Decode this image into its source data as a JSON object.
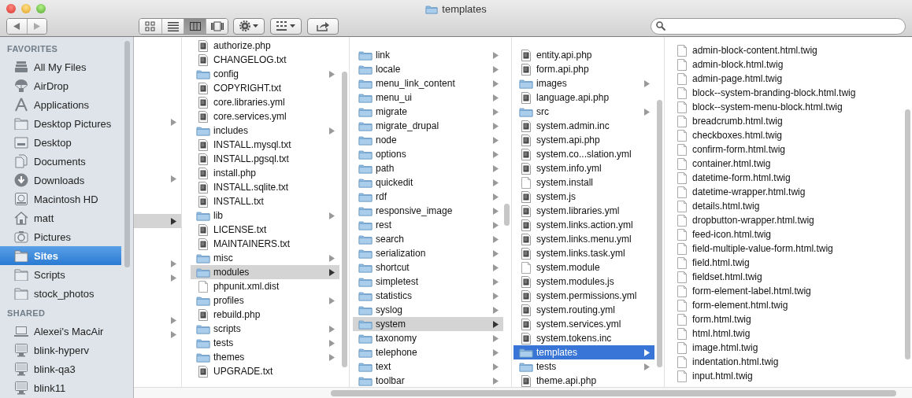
{
  "window": {
    "title": "templates"
  },
  "toolbar": {
    "view_modes": [
      {
        "kind": "icons",
        "selected": false
      },
      {
        "kind": "list",
        "selected": false
      },
      {
        "kind": "columns",
        "selected": true
      },
      {
        "kind": "coverflow",
        "selected": false
      }
    ]
  },
  "sidebar": {
    "sections": [
      {
        "heading": "FAVORITES",
        "items": [
          {
            "label": "All My Files",
            "kind": "files",
            "selected": false
          },
          {
            "label": "AirDrop",
            "kind": "airdrop",
            "selected": false
          },
          {
            "label": "Applications",
            "kind": "applications",
            "selected": false
          },
          {
            "label": "Desktop Pictures",
            "kind": "folder",
            "selected": false
          },
          {
            "label": "Desktop",
            "kind": "desktop",
            "selected": false
          },
          {
            "label": "Documents",
            "kind": "documents",
            "selected": false
          },
          {
            "label": "Downloads",
            "kind": "downloads",
            "selected": false
          },
          {
            "label": "Macintosh HD",
            "kind": "disk",
            "selected": false
          },
          {
            "label": "matt",
            "kind": "home",
            "selected": false
          },
          {
            "label": "Pictures",
            "kind": "camera",
            "selected": false
          },
          {
            "label": "Sites",
            "kind": "folder",
            "selected": true
          },
          {
            "label": "Scripts",
            "kind": "folder",
            "selected": false
          },
          {
            "label": "stock_photos",
            "kind": "folder",
            "selected": false
          }
        ]
      },
      {
        "heading": "SHARED",
        "items": [
          {
            "label": "Alexei's MacAir",
            "kind": "laptop",
            "selected": false
          },
          {
            "label": "blink-hyperv",
            "kind": "monitor",
            "selected": false
          },
          {
            "label": "blink-qa3",
            "kind": "monitor",
            "selected": false
          },
          {
            "label": "blink11",
            "kind": "monitor",
            "selected": false
          }
        ]
      }
    ]
  },
  "columns": [
    {
      "active": false,
      "rows": [
        {
          "expandable": false,
          "selected": false
        },
        {
          "expandable": false,
          "selected": false
        },
        {
          "expandable": false,
          "selected": false
        },
        {
          "expandable": false,
          "selected": false
        },
        {
          "expandable": false,
          "selected": false
        },
        {
          "expandable": true,
          "selected": false
        },
        {
          "expandable": false,
          "selected": false
        },
        {
          "expandable": false,
          "selected": false
        },
        {
          "expandable": false,
          "selected": false
        },
        {
          "expandable": true,
          "selected": false
        },
        {
          "expandable": false,
          "selected": false
        },
        {
          "expandable": false,
          "selected": false
        },
        {
          "expandable": true,
          "selected": true
        },
        {
          "expandable": false,
          "selected": false
        },
        {
          "expandable": false,
          "selected": false
        },
        {
          "expandable": true,
          "selected": false
        },
        {
          "expandable": true,
          "selected": false
        },
        {
          "expandable": false,
          "selected": false
        },
        {
          "expandable": false,
          "selected": false
        },
        {
          "expandable": true,
          "selected": false
        },
        {
          "expandable": true,
          "selected": false
        },
        {
          "expandable": false,
          "selected": false
        },
        {
          "expandable": false,
          "selected": false
        },
        {
          "expandable": false,
          "selected": false
        }
      ]
    },
    {
      "active": false,
      "rows": [
        {
          "name": "authorize.php",
          "kind": "script",
          "selected": false
        },
        {
          "name": "CHANGELOG.txt",
          "kind": "script",
          "selected": false
        },
        {
          "name": "config",
          "kind": "folder",
          "selected": false
        },
        {
          "name": "COPYRIGHT.txt",
          "kind": "script",
          "selected": false
        },
        {
          "name": "core.libraries.yml",
          "kind": "script",
          "selected": false
        },
        {
          "name": "core.services.yml",
          "kind": "script",
          "selected": false
        },
        {
          "name": "includes",
          "kind": "folder",
          "selected": false
        },
        {
          "name": "INSTALL.mysql.txt",
          "kind": "script",
          "selected": false
        },
        {
          "name": "INSTALL.pgsql.txt",
          "kind": "script",
          "selected": false
        },
        {
          "name": "install.php",
          "kind": "script",
          "selected": false
        },
        {
          "name": "INSTALL.sqlite.txt",
          "kind": "script",
          "selected": false
        },
        {
          "name": "INSTALL.txt",
          "kind": "script",
          "selected": false
        },
        {
          "name": "lib",
          "kind": "folder",
          "selected": false
        },
        {
          "name": "LICENSE.txt",
          "kind": "script",
          "selected": false
        },
        {
          "name": "MAINTAINERS.txt",
          "kind": "script",
          "selected": false
        },
        {
          "name": "misc",
          "kind": "folder",
          "selected": false
        },
        {
          "name": "modules",
          "kind": "folder",
          "selected": true
        },
        {
          "name": "phpunit.xml.dist",
          "kind": "plain",
          "selected": false
        },
        {
          "name": "profiles",
          "kind": "folder",
          "selected": false
        },
        {
          "name": "rebuild.php",
          "kind": "script",
          "selected": false
        },
        {
          "name": "scripts",
          "kind": "folder",
          "selected": false
        },
        {
          "name": "tests",
          "kind": "folder",
          "selected": false
        },
        {
          "name": "themes",
          "kind": "folder",
          "selected": false
        },
        {
          "name": "UPGRADE.txt",
          "kind": "script",
          "selected": false
        }
      ]
    },
    {
      "active": false,
      "rows": [
        {
          "name": "link",
          "kind": "folder",
          "selected": false
        },
        {
          "name": "locale",
          "kind": "folder",
          "selected": false
        },
        {
          "name": "menu_link_content",
          "kind": "folder",
          "selected": false
        },
        {
          "name": "menu_ui",
          "kind": "folder",
          "selected": false
        },
        {
          "name": "migrate",
          "kind": "folder",
          "selected": false
        },
        {
          "name": "migrate_drupal",
          "kind": "folder",
          "selected": false
        },
        {
          "name": "node",
          "kind": "folder",
          "selected": false
        },
        {
          "name": "options",
          "kind": "folder",
          "selected": false
        },
        {
          "name": "path",
          "kind": "folder",
          "selected": false
        },
        {
          "name": "quickedit",
          "kind": "folder",
          "selected": false
        },
        {
          "name": "rdf",
          "kind": "folder",
          "selected": false
        },
        {
          "name": "responsive_image",
          "kind": "folder",
          "selected": false
        },
        {
          "name": "rest",
          "kind": "folder",
          "selected": false
        },
        {
          "name": "search",
          "kind": "folder",
          "selected": false
        },
        {
          "name": "serialization",
          "kind": "folder",
          "selected": false
        },
        {
          "name": "shortcut",
          "kind": "folder",
          "selected": false
        },
        {
          "name": "simpletest",
          "kind": "folder",
          "selected": false
        },
        {
          "name": "statistics",
          "kind": "folder",
          "selected": false
        },
        {
          "name": "syslog",
          "kind": "folder",
          "selected": false
        },
        {
          "name": "system",
          "kind": "folder",
          "selected": true
        },
        {
          "name": "taxonomy",
          "kind": "folder",
          "selected": false
        },
        {
          "name": "telephone",
          "kind": "folder",
          "selected": false
        },
        {
          "name": "text",
          "kind": "folder",
          "selected": false
        },
        {
          "name": "toolbar",
          "kind": "folder",
          "selected": false
        }
      ]
    },
    {
      "active": true,
      "rows": [
        {
          "name": "entity.api.php",
          "kind": "script",
          "selected": false
        },
        {
          "name": "form.api.php",
          "kind": "script",
          "selected": false
        },
        {
          "name": "images",
          "kind": "folder",
          "selected": false
        },
        {
          "name": "language.api.php",
          "kind": "script",
          "selected": false
        },
        {
          "name": "src",
          "kind": "folder",
          "selected": false
        },
        {
          "name": "system.admin.inc",
          "kind": "script",
          "selected": false
        },
        {
          "name": "system.api.php",
          "kind": "script",
          "selected": false
        },
        {
          "name": "system.co...slation.yml",
          "kind": "script",
          "selected": false
        },
        {
          "name": "system.info.yml",
          "kind": "script",
          "selected": false
        },
        {
          "name": "system.install",
          "kind": "plain",
          "selected": false
        },
        {
          "name": "system.js",
          "kind": "script",
          "selected": false
        },
        {
          "name": "system.libraries.yml",
          "kind": "script",
          "selected": false
        },
        {
          "name": "system.links.action.yml",
          "kind": "script",
          "selected": false
        },
        {
          "name": "system.links.menu.yml",
          "kind": "script",
          "selected": false
        },
        {
          "name": "system.links.task.yml",
          "kind": "script",
          "selected": false
        },
        {
          "name": "system.module",
          "kind": "plain",
          "selected": false
        },
        {
          "name": "system.modules.js",
          "kind": "script",
          "selected": false
        },
        {
          "name": "system.permissions.yml",
          "kind": "script",
          "selected": false
        },
        {
          "name": "system.routing.yml",
          "kind": "script",
          "selected": false
        },
        {
          "name": "system.services.yml",
          "kind": "script",
          "selected": false
        },
        {
          "name": "system.tokens.inc",
          "kind": "script",
          "selected": false
        },
        {
          "name": "templates",
          "kind": "folder",
          "selected": true
        },
        {
          "name": "tests",
          "kind": "folder",
          "selected": false
        },
        {
          "name": "theme.api.php",
          "kind": "script",
          "selected": false
        }
      ]
    },
    {
      "rows": [
        {
          "name": "admin-block-content.html.twig",
          "kind": "plain",
          "selected": false
        },
        {
          "name": "admin-block.html.twig",
          "kind": "plain",
          "selected": false
        },
        {
          "name": "admin-page.html.twig",
          "kind": "plain",
          "selected": false
        },
        {
          "name": "block--system-branding-block.html.twig",
          "kind": "plain",
          "selected": false
        },
        {
          "name": "block--system-menu-block.html.twig",
          "kind": "plain",
          "selected": false
        },
        {
          "name": "breadcrumb.html.twig",
          "kind": "plain",
          "selected": false
        },
        {
          "name": "checkboxes.html.twig",
          "kind": "plain",
          "selected": false
        },
        {
          "name": "confirm-form.html.twig",
          "kind": "plain",
          "selected": false
        },
        {
          "name": "container.html.twig",
          "kind": "plain",
          "selected": false
        },
        {
          "name": "datetime-form.html.twig",
          "kind": "plain",
          "selected": false
        },
        {
          "name": "datetime-wrapper.html.twig",
          "kind": "plain",
          "selected": false
        },
        {
          "name": "details.html.twig",
          "kind": "plain",
          "selected": false
        },
        {
          "name": "dropbutton-wrapper.html.twig",
          "kind": "plain",
          "selected": false
        },
        {
          "name": "feed-icon.html.twig",
          "kind": "plain",
          "selected": false
        },
        {
          "name": "field-multiple-value-form.html.twig",
          "kind": "plain",
          "selected": false
        },
        {
          "name": "field.html.twig",
          "kind": "plain",
          "selected": false
        },
        {
          "name": "fieldset.html.twig",
          "kind": "plain",
          "selected": false
        },
        {
          "name": "form-element-label.html.twig",
          "kind": "plain",
          "selected": false
        },
        {
          "name": "form-element.html.twig",
          "kind": "plain",
          "selected": false
        },
        {
          "name": "form.html.twig",
          "kind": "plain",
          "selected": false
        },
        {
          "name": "html.html.twig",
          "kind": "plain",
          "selected": false
        },
        {
          "name": "image.html.twig",
          "kind": "plain",
          "selected": false
        },
        {
          "name": "indentation.html.twig",
          "kind": "plain",
          "selected": false
        },
        {
          "name": "input.html.twig",
          "kind": "plain",
          "selected": false
        }
      ]
    }
  ]
}
